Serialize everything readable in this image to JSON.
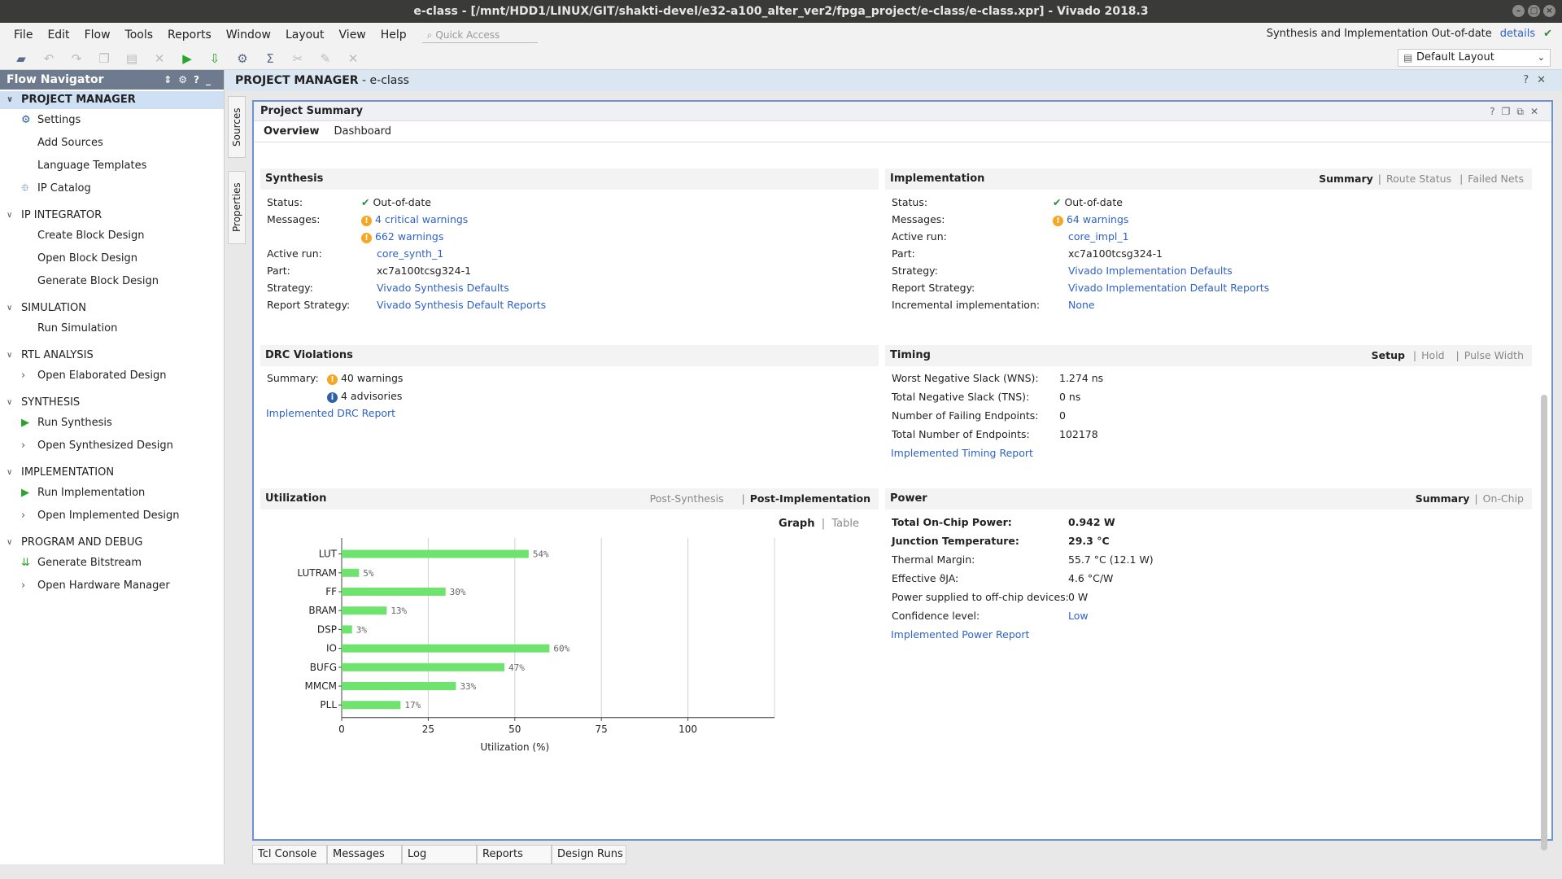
{
  "window": {
    "title": "e-class - [/mnt/HDD1/LINUX/GIT/shakti-devel/e32-a100_alter_ver2/fpga_project/e-class/e-class.xpr] - Vivado 2018.3"
  },
  "menu": [
    "File",
    "Edit",
    "Flow",
    "Tools",
    "Reports",
    "Window",
    "Layout",
    "View",
    "Help"
  ],
  "quick_access": "Quick Access",
  "status_top": {
    "text": "Synthesis and Implementation Out-of-date",
    "link": "details"
  },
  "layout_select": "Default Layout",
  "flow_navigator": {
    "title": "Flow Navigator",
    "sections": [
      {
        "label": "PROJECT MANAGER",
        "items": [
          {
            "label": "Settings",
            "icon": "gear-icon"
          },
          {
            "label": "Add Sources",
            "icon": ""
          },
          {
            "label": "Language Templates",
            "icon": ""
          },
          {
            "label": "IP Catalog",
            "icon": "ip-icon"
          }
        ]
      },
      {
        "label": "IP INTEGRATOR",
        "items": [
          {
            "label": "Create Block Design",
            "icon": ""
          },
          {
            "label": "Open Block Design",
            "icon": ""
          },
          {
            "label": "Generate Block Design",
            "icon": ""
          }
        ]
      },
      {
        "label": "SIMULATION",
        "items": [
          {
            "label": "Run Simulation",
            "icon": ""
          }
        ]
      },
      {
        "label": "RTL ANALYSIS",
        "items": [
          {
            "label": "Open Elaborated Design",
            "icon": "chevron-right-icon"
          }
        ]
      },
      {
        "label": "SYNTHESIS",
        "items": [
          {
            "label": "Run Synthesis",
            "icon": "play-icon"
          },
          {
            "label": "Open Synthesized Design",
            "icon": "chevron-right-icon"
          }
        ]
      },
      {
        "label": "IMPLEMENTATION",
        "items": [
          {
            "label": "Run Implementation",
            "icon": "play-icon"
          },
          {
            "label": "Open Implemented Design",
            "icon": "chevron-right-icon"
          }
        ]
      },
      {
        "label": "PROGRAM AND DEBUG",
        "items": [
          {
            "label": "Generate Bitstream",
            "icon": "bitstream-icon"
          },
          {
            "label": "Open Hardware Manager",
            "icon": "chevron-right-icon"
          }
        ]
      }
    ]
  },
  "side_tabs": [
    "Sources",
    "Properties"
  ],
  "pm_header": {
    "title": "PROJECT MANAGER",
    "project": "e-class"
  },
  "summary": {
    "title": "Project Summary",
    "tabs": [
      "Overview",
      "Dashboard"
    ],
    "synthesis": {
      "title": "Synthesis",
      "status_label": "Status:",
      "status": "Out-of-date",
      "messages_label": "Messages:",
      "critical": "4 critical warnings",
      "warnings": "662 warnings",
      "run_label": "Active run:",
      "run": "core_synth_1",
      "part_label": "Part:",
      "part": "xc7a100tcsg324-1",
      "strategy_label": "Strategy:",
      "strategy": "Vivado Synthesis Defaults",
      "report_label": "Report Strategy:",
      "report": "Vivado Synthesis Default Reports"
    },
    "implementation": {
      "title": "Implementation",
      "tabs": [
        "Summary",
        "Route Status",
        "Failed Nets"
      ],
      "status_label": "Status:",
      "status": "Out-of-date",
      "messages_label": "Messages:",
      "warnings": "64 warnings",
      "run_label": "Active run:",
      "run": "core_impl_1",
      "part_label": "Part:",
      "part": "xc7a100tcsg324-1",
      "strategy_label": "Strategy:",
      "strategy": "Vivado Implementation Defaults",
      "report_label": "Report Strategy:",
      "report": "Vivado Implementation Default Reports",
      "incr_label": "Incremental implementation:",
      "incr": "None"
    },
    "drc": {
      "title": "DRC Violations",
      "summary_label": "Summary:",
      "warnings": "40 warnings",
      "advisories": "4 advisories",
      "report": "Implemented DRC Report"
    },
    "timing": {
      "title": "Timing",
      "tabs": [
        "Setup",
        "Hold",
        "Pulse Width"
      ],
      "rows": [
        {
          "label": "Worst Negative Slack (WNS):",
          "value": "1.274 ns"
        },
        {
          "label": "Total Negative Slack (TNS):",
          "value": "0 ns"
        },
        {
          "label": "Number of Failing Endpoints:",
          "value": "0"
        },
        {
          "label": "Total Number of Endpoints:",
          "value": "102178"
        }
      ],
      "report": "Implemented Timing Report"
    },
    "utilization": {
      "title": "Utilization",
      "tabs": [
        "Post-Synthesis",
        "Post-Implementation"
      ],
      "views": [
        "Graph",
        "Table"
      ]
    },
    "power": {
      "title": "Power",
      "tabs": [
        "Summary",
        "On-Chip"
      ],
      "rows": [
        {
          "label": "Total On-Chip Power:",
          "value": "0.942 W",
          "bold": true
        },
        {
          "label": "Junction Temperature:",
          "value": "29.3 °C",
          "bold": true
        },
        {
          "label": "Thermal Margin:",
          "value": "55.7 °C (12.1 W)",
          "bold": false
        },
        {
          "label": "Effective ϑJA:",
          "value": "4.6 °C/W",
          "bold": false
        },
        {
          "label": "Power supplied to off-chip devices:",
          "value": "0 W",
          "bold": false
        },
        {
          "label": "Confidence level:",
          "value": "Low",
          "bold": false,
          "link": true
        }
      ],
      "report": "Implemented Power Report"
    }
  },
  "chart_data": {
    "type": "bar",
    "orientation": "horizontal",
    "categories": [
      "LUT",
      "LUTRAM",
      "FF",
      "BRAM",
      "DSP",
      "IO",
      "BUFG",
      "MMCM",
      "PLL"
    ],
    "values": [
      54,
      5,
      30,
      13,
      3,
      60,
      47,
      33,
      17
    ],
    "value_labels": [
      "54%",
      "5%",
      "30%",
      "13%",
      "3%",
      "60%",
      "47%",
      "33%",
      "17%"
    ],
    "xlabel": "Utilization (%)",
    "xticks": [
      0,
      25,
      50,
      75,
      100
    ],
    "xlim": [
      0,
      125
    ],
    "grid": true,
    "bar_color": "#6ee46e"
  },
  "bottom_tabs": [
    "Tcl Console",
    "Messages",
    "Log",
    "Reports",
    "Design Runs"
  ]
}
